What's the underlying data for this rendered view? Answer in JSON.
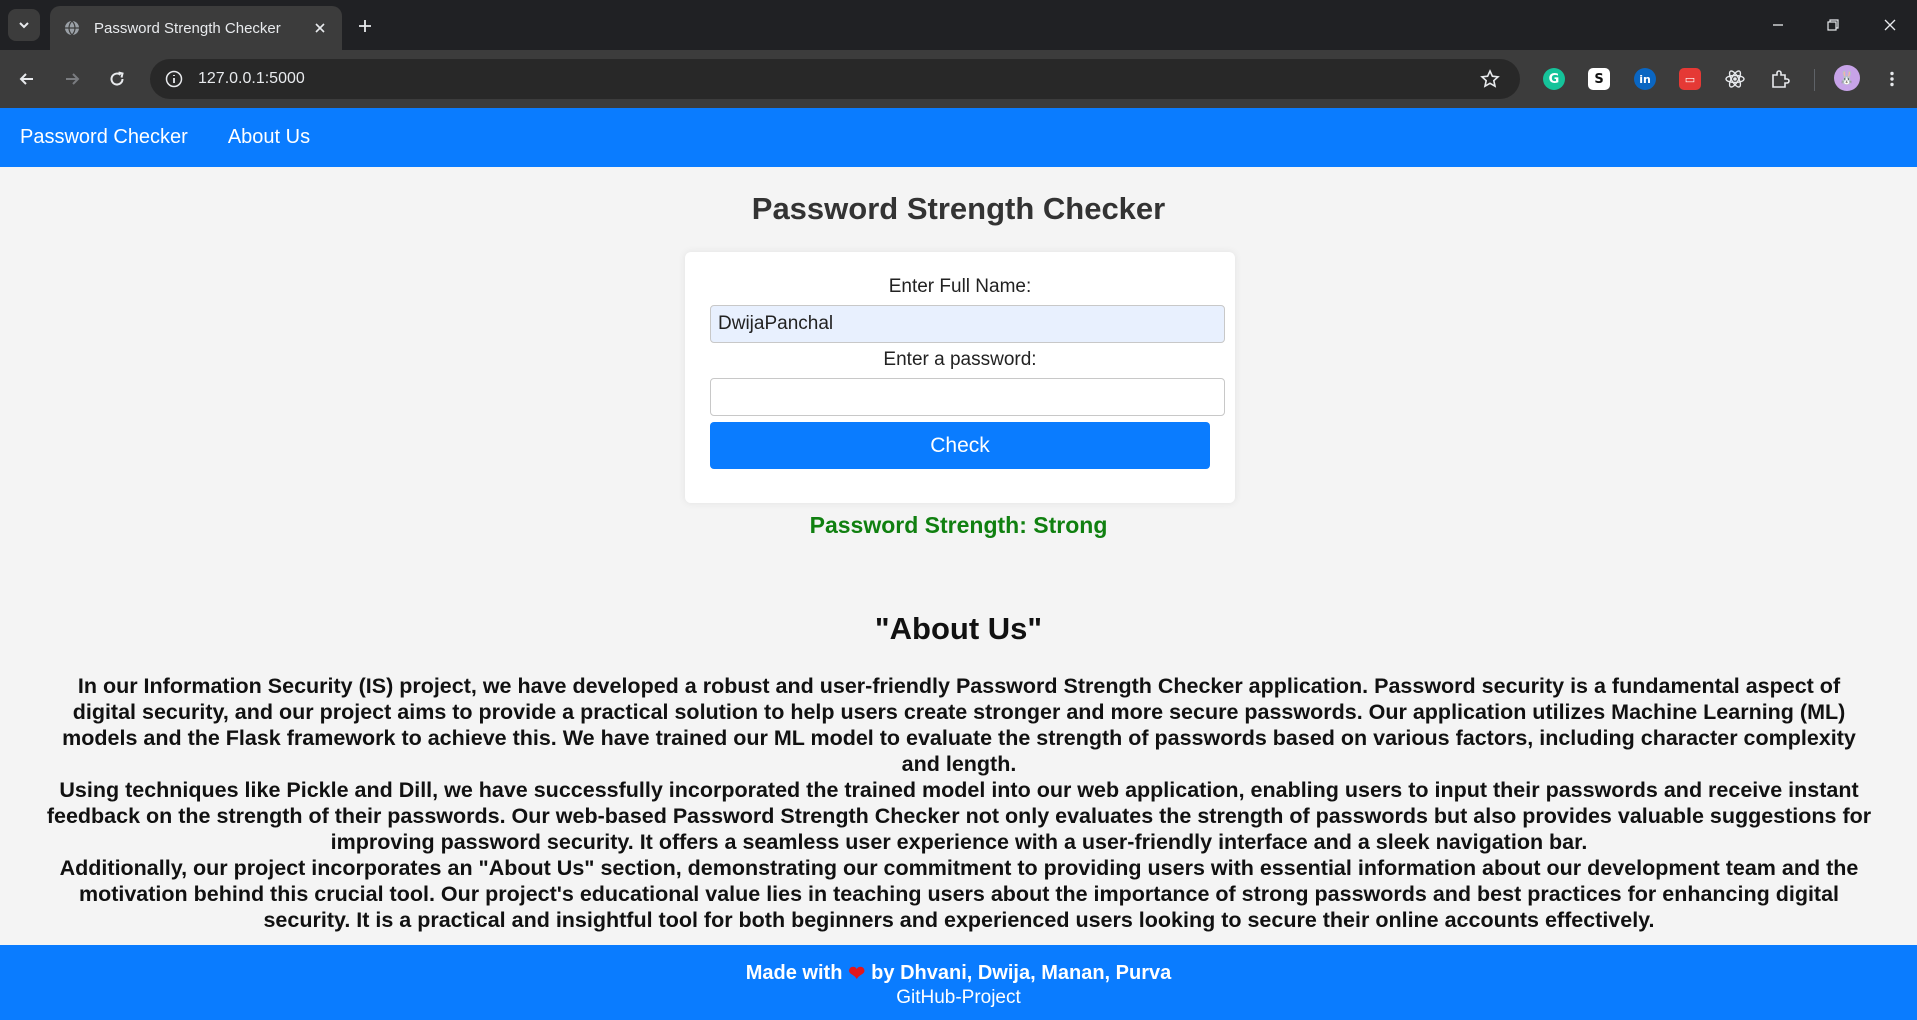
{
  "browser": {
    "tab_title": "Password Strength Checker",
    "url": "127.0.0.1:5000",
    "extensions": [
      {
        "name": "grammarly-icon",
        "glyph": "G",
        "color": "#15c39a"
      },
      {
        "name": "s-extension-icon",
        "glyph": "S",
        "color": "#ffffff"
      },
      {
        "name": "linkedin-extension-icon",
        "glyph": "in",
        "color": "#0a66c2"
      },
      {
        "name": "red-extension-icon",
        "glyph": "▭",
        "color": "#e53935"
      },
      {
        "name": "react-devtools-icon",
        "glyph": "⚛",
        "color": "#e8eaed"
      },
      {
        "name": "extensions-puzzle-icon",
        "glyph": "",
        "color": "#e8eaed"
      }
    ]
  },
  "nav": {
    "items": [
      {
        "label": "Password Checker"
      },
      {
        "label": "About Us"
      }
    ]
  },
  "main": {
    "title": "Password Strength Checker",
    "form": {
      "name_label": "Enter Full Name:",
      "name_value": "DwijaPanchal",
      "password_label": "Enter a password:",
      "password_value": "",
      "check_label": "Check"
    },
    "result": "Password Strength: Strong"
  },
  "about": {
    "heading": "\"About Us\"",
    "paragraphs": [
      "In our Information Security (IS) project, we have developed a robust and user-friendly Password Strength Checker application. Password security is a fundamental aspect of digital security, and our project aims to provide a practical solution to help users create stronger and more secure passwords. Our application utilizes Machine Learning (ML) models and the Flask framework to achieve this. We have trained our ML model to evaluate the strength of passwords based on various factors, including character complexity and length.",
      "Using techniques like Pickle and Dill, we have successfully incorporated the trained model into our web application, enabling users to input their passwords and receive instant feedback on the strength of their passwords. Our web-based Password Strength Checker not only evaluates the strength of passwords but also provides valuable suggestions for improving password security. It offers a seamless user experience with a user-friendly interface and a sleek navigation bar.",
      "Additionally, our project incorporates an \"About Us\" section, demonstrating our commitment to providing users with essential information about our development team and the motivation behind this crucial tool. Our project's educational value lies in teaching users about the importance of strong passwords and best practices for enhancing digital security. It is a practical and insightful tool for both beginners and experienced users looking to secure their online accounts effectively."
    ]
  },
  "footer": {
    "made_prefix": "Made with",
    "made_suffix": "by Dhvani, Dwija, Manan, Purva",
    "github_link": "GitHub-Project"
  },
  "colors": {
    "primary": "#0a7cff",
    "success": "#108010",
    "heart": "#e3161b"
  }
}
